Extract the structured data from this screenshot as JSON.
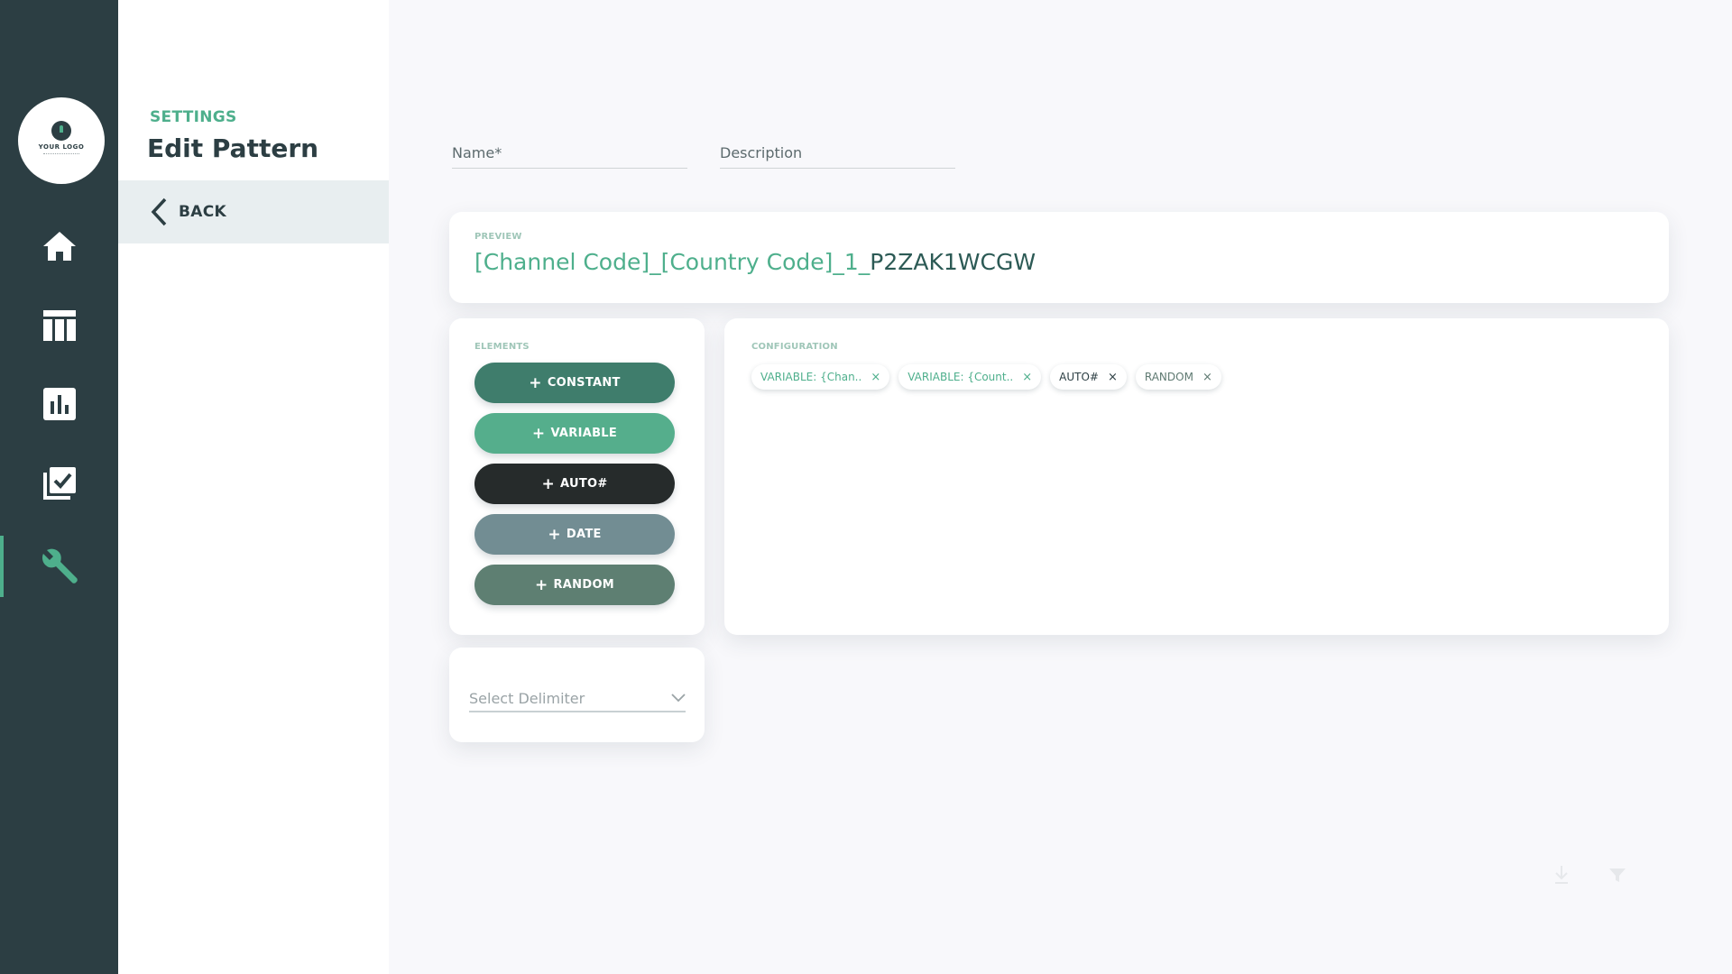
{
  "rail": {
    "logo_text": "YOUR LOGO",
    "items": [
      {
        "name": "home",
        "icon": "home-icon"
      },
      {
        "name": "table",
        "icon": "table-icon"
      },
      {
        "name": "reports",
        "icon": "bar-chart-icon"
      },
      {
        "name": "checklist",
        "icon": "checklist-icon"
      },
      {
        "name": "settings",
        "icon": "wrench-icon",
        "active": true
      }
    ],
    "active_color": "#4eaf8c",
    "background": "#2c3e43"
  },
  "header": {
    "section": "SETTINGS",
    "title": "Edit Pattern",
    "back_label": "BACK"
  },
  "form": {
    "name_placeholder": "Name*",
    "description_placeholder": "Description"
  },
  "preview": {
    "label": "PREVIEW",
    "green_part": "[Channel Code]_[Country Code]_1_",
    "dark_part": "P2ZAK1WCGW"
  },
  "elements": {
    "label": "ELEMENTS",
    "buttons": [
      {
        "label": "CONSTANT",
        "color": "#3f7d6c"
      },
      {
        "label": "VARIABLE",
        "color": "#55ae8c"
      },
      {
        "label": "AUTO#",
        "color": "#262b2b"
      },
      {
        "label": "DATE",
        "color": "#728d93"
      },
      {
        "label": "RANDOM",
        "color": "#5e7f72"
      }
    ]
  },
  "configuration": {
    "label": "CONFIGURATION",
    "chips": [
      {
        "label": "VARIABLE: {Chan..",
        "style": "green"
      },
      {
        "label": "VARIABLE: {Count..",
        "style": "green"
      },
      {
        "label": "AUTO#",
        "style": "dark"
      },
      {
        "label": "RANDOM",
        "style": "muted"
      }
    ],
    "remove_glyph": "×"
  },
  "delimiter": {
    "placeholder": "Select Delimiter"
  }
}
